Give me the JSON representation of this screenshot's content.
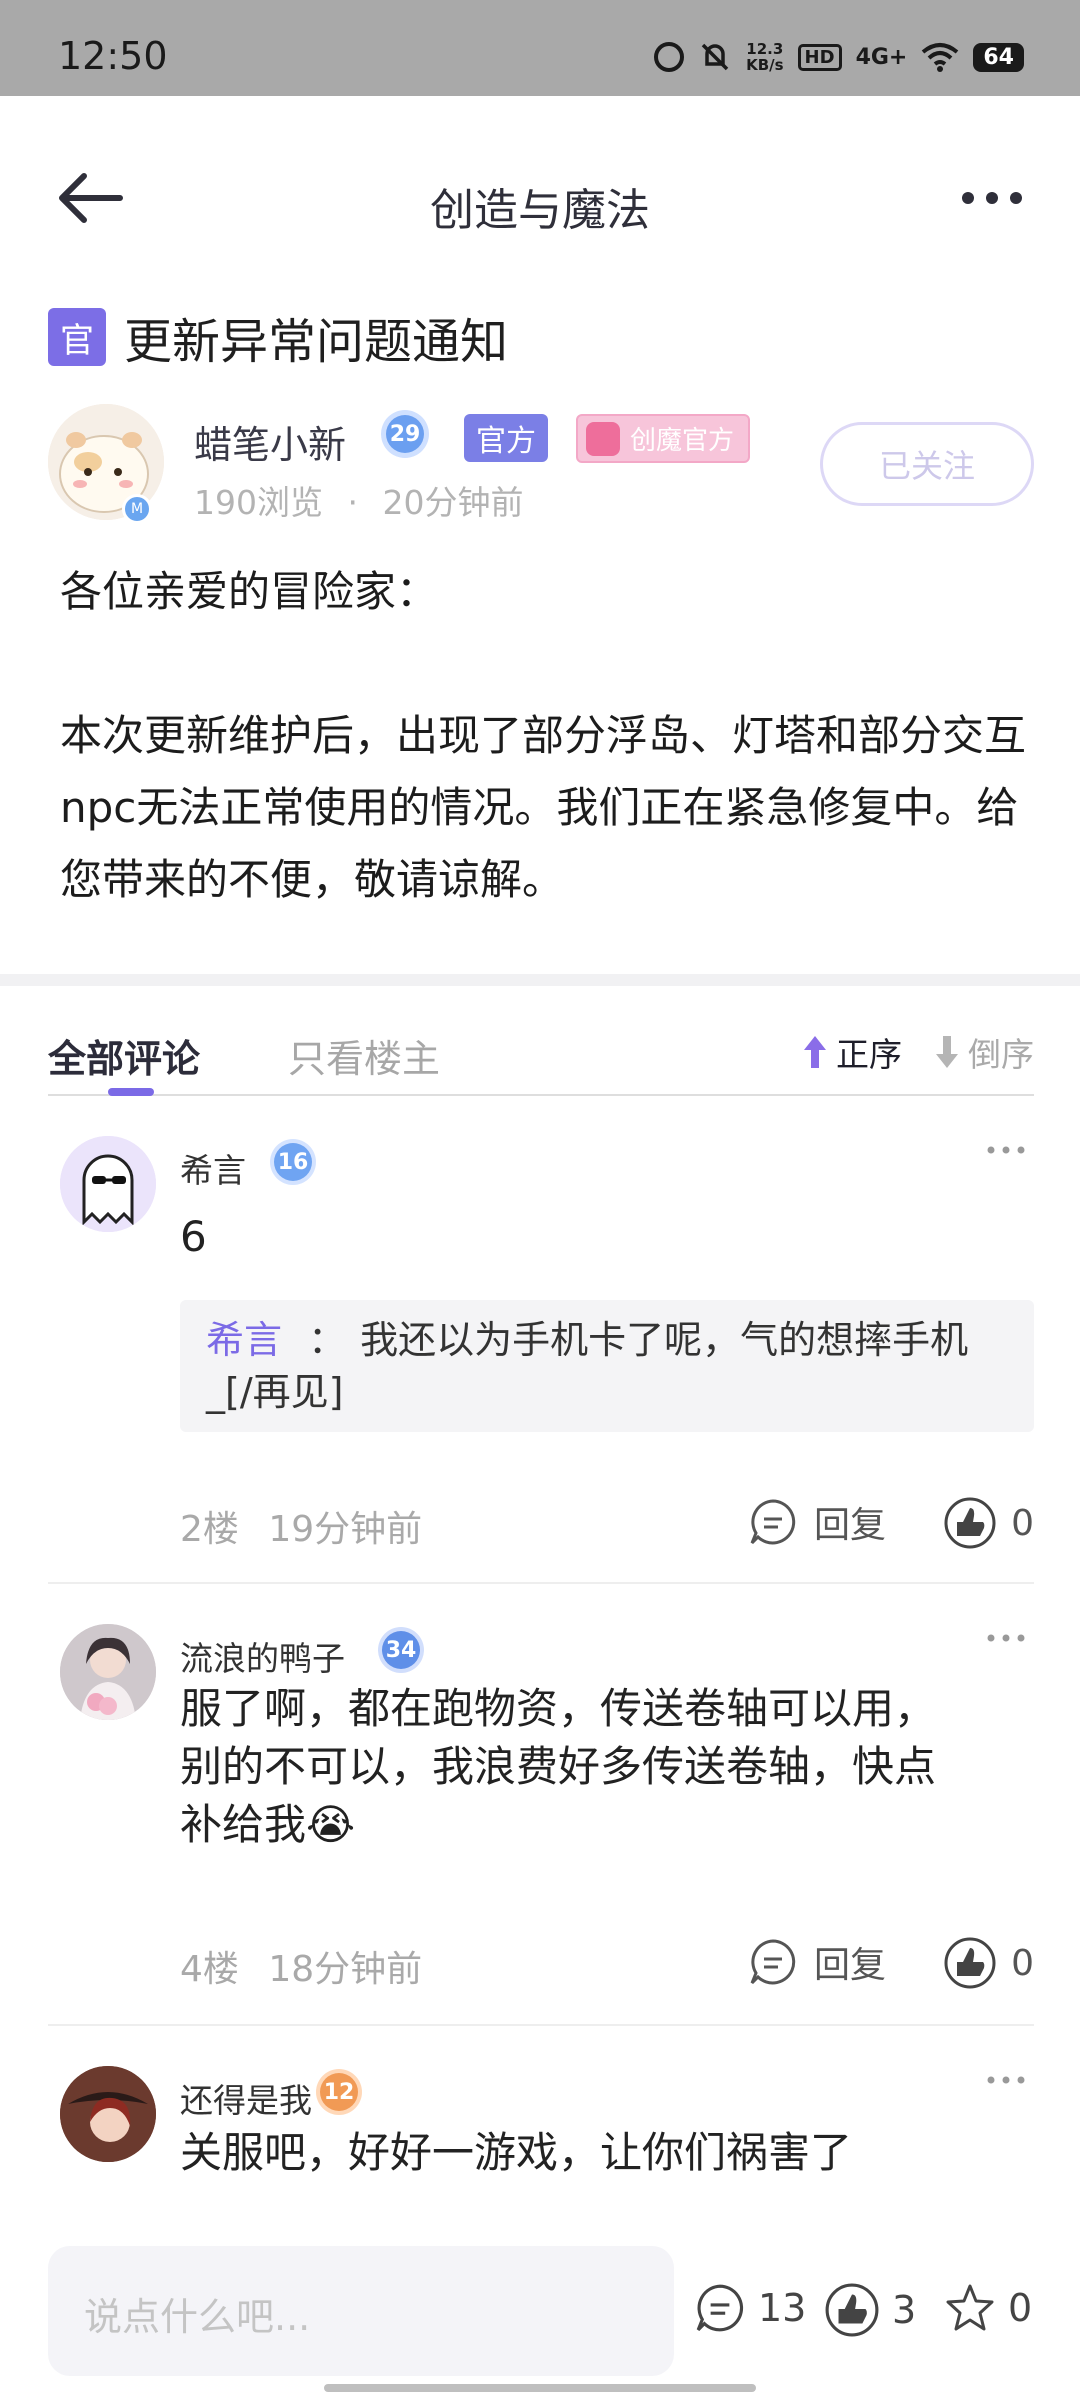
{
  "status_bar": {
    "time": "12:50",
    "net_speed_value": "12.3",
    "net_speed_unit": "KB/s",
    "hd": "HD",
    "signal": "4G+",
    "battery": "64",
    "icons": [
      "alarm-icon",
      "mute-icon",
      "wifi-icon",
      "battery-icon"
    ]
  },
  "header": {
    "title": "创造与魔法",
    "back_icon": "arrow-left-icon",
    "more_icon": "more-horizontal-icon"
  },
  "post": {
    "tag": "官",
    "title": "更新异常问题通知",
    "author": {
      "name": "蜡笔小新",
      "level": "29",
      "tag_official": "官方",
      "tag_team": "创魔官方",
      "avatar_badge": "M",
      "views": "190浏览",
      "separator": "·",
      "time": "20分钟前",
      "follow_label": "已关注"
    },
    "body": [
      "各位亲爱的冒险家：",
      "本次更新维护后，出现了部分浮岛、灯塔和部分交互npc无法正常使用的情况。我们正在紧急修复中。给您带来的不便，敬请谅解。"
    ]
  },
  "comments_tabs": {
    "all": "全部评论",
    "owner_only": "只看楼主",
    "sort_asc": "正序",
    "sort_desc": "倒序"
  },
  "comments": [
    {
      "name": "希言",
      "level": "16",
      "text": "6",
      "quote_name": "希言",
      "quote_sep": "：",
      "quote_text": "我还以为手机卡了呢，气的想摔手机_[/再见]",
      "floor": "2楼",
      "time": "19分钟前",
      "reply_label": "回复",
      "likes": "0"
    },
    {
      "name": "流浪的鸭子",
      "level": "34",
      "text": "服了啊，都在跑物资，传送卷轴可以用，别的不可以，我浪费好多传送卷轴，快点补给我",
      "emoji": "😭",
      "floor": "4楼",
      "time": "18分钟前",
      "reply_label": "回复",
      "likes": "0"
    },
    {
      "name": "还得是我",
      "level": "12",
      "text": "关服吧，好好一游戏，让你们祸害了"
    }
  ],
  "bottom_bar": {
    "placeholder": "说点什么吧...",
    "comment_count": "13",
    "like_count": "3",
    "favorite_count": "0"
  },
  "colors": {
    "accent": "#7b6ae6",
    "status_bar": "#a9a9a9"
  }
}
